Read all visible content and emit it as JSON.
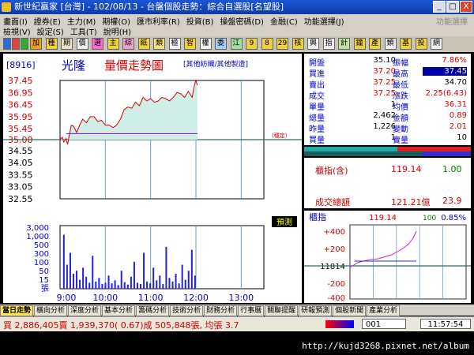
{
  "window": {
    "title": "新世紀贏家 [台灣] - 102/08/13 - 台盤個股走勢：綜合自選股[名望股]",
    "min_glyph": "_",
    "max_glyph": "□",
    "close_glyph": "X"
  },
  "menu": {
    "row1": [
      "畫面(I)",
      "證券(E)",
      "主力(M)",
      "期權(O)",
      "匯市利率(R)",
      "投資(B)",
      "操盤密碼(D)",
      "金融(C)",
      "功能選擇(J)"
    ],
    "row2": [
      "檢視(V)",
      "設定(S)",
      "工具(T)",
      "說明(H)"
    ],
    "right_gray": "功能選擇"
  },
  "toolbar": {
    "buttons": [
      "加",
      "種",
      "期",
      "價",
      "選",
      "主",
      "綜",
      "紙",
      "類",
      "極",
      "智",
      "權",
      "委",
      "江",
      "9",
      "8",
      "29",
      "核",
      "興",
      "指",
      "計",
      "鐘",
      "產",
      "類",
      "基",
      "投",
      "網"
    ]
  },
  "stock": {
    "code": "[8916]",
    "name": "光隆",
    "chart_title": "量價走勢圖",
    "category": "[其他紡織/其他製造]",
    "marker_label": "(穩定)",
    "forecast_button": "預測"
  },
  "stats": {
    "left": [
      {
        "label": "開盤",
        "value": "35.10"
      },
      {
        "label": "買進",
        "value": "37.20"
      },
      {
        "label": "賣出",
        "value": "37.25"
      },
      {
        "label": "成交",
        "value": "37.25"
      },
      {
        "label": "單量",
        "value": "1"
      },
      {
        "label": "總量",
        "value": "2,462"
      },
      {
        "label": "昨量",
        "value": "1,226"
      },
      {
        "label": "買量",
        "value": "1"
      }
    ],
    "right": [
      {
        "label": "振幅",
        "value": "7.86%"
      },
      {
        "label": "最高",
        "value": "37.45"
      },
      {
        "label": "最低",
        "value": "34.70"
      },
      {
        "label": "漲跌",
        "value": "2.25(6.43)"
      },
      {
        "label": "均價",
        "value": "36.31"
      },
      {
        "label": "金額",
        "value": "0.89"
      },
      {
        "label": "變動",
        "value": "2.01"
      },
      {
        "label": "賣量",
        "value": "10"
      }
    ]
  },
  "index_box": {
    "label1": "櫃指(含)",
    "value1": "119.14",
    "change1": "1.00",
    "label2": "成交總額",
    "value2": "121.21億",
    "change2": "23.9"
  },
  "mini": {
    "title": "櫃指",
    "value": "119.14",
    "change": "100",
    "pct": "0.85%",
    "y_ticks": [
      "+400",
      "+200",
      "11814",
      "-200",
      "-400"
    ]
  },
  "colors": {
    "up": "#d40000",
    "down": "#008000",
    "label": "#0000cc",
    "grid": "#6aa0c8",
    "fill": "#cfeee8",
    "avg": "#9900cc",
    "volume": "#2222dd"
  },
  "chart_data": {
    "type": "line",
    "x_ticks": [
      "9:00",
      "10:00",
      "11:00",
      "12:00",
      "13:00"
    ],
    "y_ticks": [
      37.45,
      36.95,
      36.45,
      35.95,
      35.45,
      35.0,
      34.55,
      34.05,
      33.55,
      33.05,
      32.55
    ],
    "ylim": [
      32.55,
      37.45
    ],
    "reference_price": 35.0,
    "avg_price": 35.25,
    "price": [
      [
        0,
        35.0
      ],
      [
        3,
        35.1
      ],
      [
        5,
        34.9
      ],
      [
        8,
        35.05
      ],
      [
        10,
        34.8
      ],
      [
        12,
        35.15
      ],
      [
        15,
        35.6
      ],
      [
        18,
        35.55
      ],
      [
        22,
        35.3
      ],
      [
        26,
        35.6
      ],
      [
        30,
        35.85
      ],
      [
        35,
        35.7
      ],
      [
        40,
        35.95
      ],
      [
        45,
        35.95
      ],
      [
        50,
        35.75
      ],
      [
        55,
        35.8
      ],
      [
        60,
        35.6
      ],
      [
        65,
        35.6
      ],
      [
        70,
        35.5
      ],
      [
        73,
        35.55
      ],
      [
        76,
        35.65
      ],
      [
        80,
        35.85
      ],
      [
        85,
        36.25
      ],
      [
        90,
        36.35
      ],
      [
        95,
        36.3
      ],
      [
        100,
        36.55
      ],
      [
        105,
        36.4
      ],
      [
        110,
        36.75
      ],
      [
        115,
        36.6
      ],
      [
        120,
        36.7
      ],
      [
        125,
        36.55
      ],
      [
        130,
        36.6
      ],
      [
        135,
        36.75
      ],
      [
        140,
        36.7
      ],
      [
        145,
        36.6
      ],
      [
        150,
        36.75
      ],
      [
        155,
        36.95
      ],
      [
        160,
        36.9
      ],
      [
        165,
        36.75
      ],
      [
        170,
        37.0
      ],
      [
        175,
        36.75
      ],
      [
        178,
        37.25
      ],
      [
        180,
        37.45
      ],
      [
        182,
        37.25
      ]
    ],
    "volume_ticks": [
      "3,000",
      "1,000",
      "500",
      "300",
      "100",
      "50",
      "15",
      "張"
    ],
    "volume": [
      90,
      40,
      60,
      25,
      30,
      15,
      35,
      20,
      10,
      55,
      12,
      18,
      8,
      10,
      22,
      9,
      14,
      6,
      30,
      11,
      7,
      20,
      45,
      10,
      8,
      60,
      12,
      9,
      35,
      14,
      22,
      8,
      70,
      18,
      12,
      25,
      9,
      40,
      15,
      30,
      65,
      22
    ]
  },
  "tabs": [
    "當日走勢",
    "橫向分析",
    "深度分析",
    "基本分析",
    "籌碼分析",
    "技術分析",
    "財務分析",
    "行事曆",
    "關聯提醒",
    "研報預測",
    "個股新聞",
    "產業分析"
  ],
  "status": {
    "text": "買 2,886,405賣 1,939,370( 0.67)成 505,848張, 均張 3.7",
    "code": "001",
    "time": "11:57:54"
  },
  "watermark": "http://kujd3268.pixnet.net/album"
}
